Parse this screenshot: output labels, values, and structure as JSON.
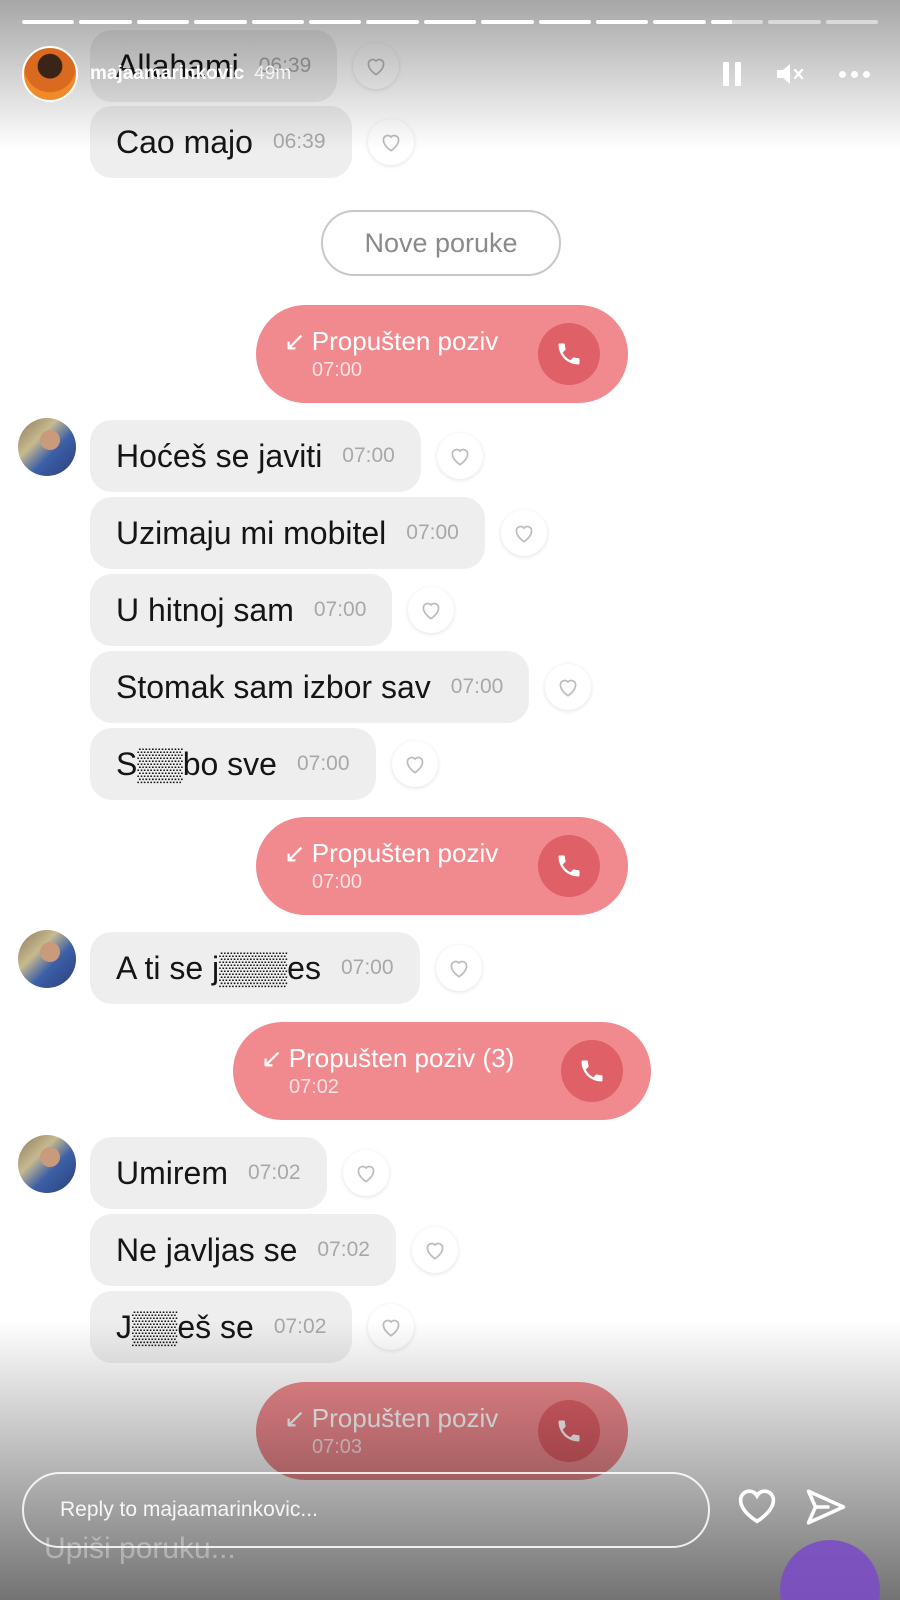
{
  "story": {
    "username": "majaamarinkovic",
    "time_ago": "49m",
    "progress_segments": 15,
    "progress_completed": 12,
    "reply_placeholder": "Reply to majaamarinkovic..."
  },
  "chat": {
    "top_partial": {
      "text": "Allahami",
      "time": "06:39"
    },
    "messages": [
      {
        "text": "Cao majo",
        "time": "06:39"
      },
      {
        "text": "Hoćeš se javiti",
        "time": "07:00"
      },
      {
        "text": "Uzimaju mi mobitel",
        "time": "07:00"
      },
      {
        "text": "U hitnoj sam",
        "time": "07:00"
      },
      {
        "text": "Stomak sam izbor sav",
        "time": "07:00"
      },
      {
        "text": "S▒▒bo sve",
        "time": "07:00"
      },
      {
        "text": "A ti se j▒▒▒es",
        "time": "07:00"
      },
      {
        "text": "Umirem",
        "time": "07:02"
      },
      {
        "text": "Ne javljas se",
        "time": "07:02"
      },
      {
        "text": "J▒▒eš se",
        "time": "07:02"
      }
    ],
    "new_messages_label": "Nove poruke",
    "missed_calls": [
      {
        "label": "Propušten poziv",
        "time": "07:00"
      },
      {
        "label": "Propušten poziv",
        "time": "07:00"
      },
      {
        "label": "Propušten poziv (3)",
        "time": "07:02"
      },
      {
        "label": "Propušten poziv",
        "time": "07:03"
      }
    ],
    "compose_placeholder": "Upiši poruku..."
  },
  "colors": {
    "missed_call_bg": "#f08a8f",
    "phone_circle": "#e06068",
    "bubble_bg": "#eeeeee"
  },
  "icons": {
    "pause": "pause-icon",
    "mute": "mute-icon",
    "more": "more-icon",
    "heart": "heart-icon",
    "send": "send-icon",
    "phone": "phone-icon",
    "missed_arrow": "missed-call-arrow-icon"
  }
}
